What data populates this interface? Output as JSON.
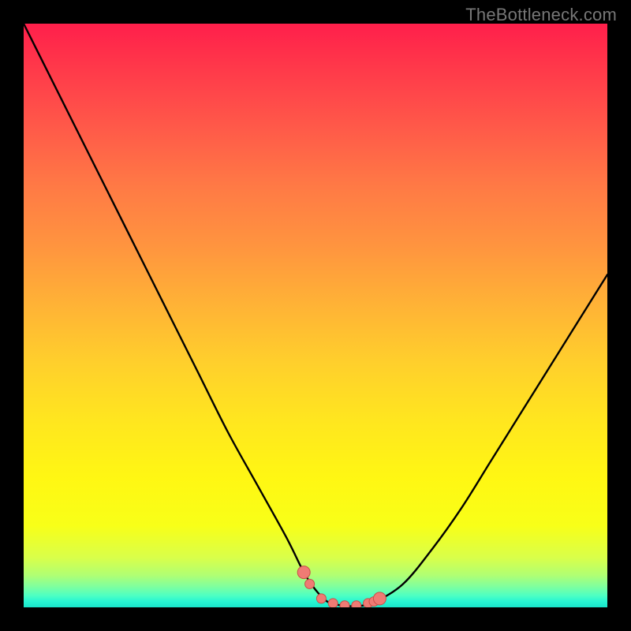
{
  "watermark": "TheBottleneck.com",
  "colors": {
    "frame_bg": "#000000",
    "curve_stroke": "#000000",
    "marker_fill": "#ef7b74",
    "marker_stroke": "#c94f48"
  },
  "chart_data": {
    "type": "line",
    "title": "",
    "xlabel": "",
    "ylabel": "",
    "xlim": [
      0,
      100
    ],
    "ylim": [
      0,
      100
    ],
    "grid": false,
    "legend": false,
    "series": [
      {
        "name": "bottleneck-curve",
        "x": [
          0,
          5,
          10,
          15,
          20,
          25,
          30,
          35,
          40,
          45,
          48,
          50,
          52,
          54,
          56,
          58,
          60,
          65,
          70,
          75,
          80,
          85,
          90,
          95,
          100
        ],
        "values": [
          100,
          90,
          80,
          70,
          60,
          50,
          40,
          30,
          21,
          12,
          6,
          3,
          1,
          0.4,
          0.2,
          0.3,
          0.8,
          4,
          10,
          17,
          25,
          33,
          41,
          49,
          57
        ]
      }
    ],
    "markers": {
      "name": "optimal-range-markers",
      "x": [
        48,
        49,
        51,
        53,
        55,
        57,
        59,
        60,
        61
      ],
      "values": [
        6.0,
        4.0,
        1.5,
        0.7,
        0.3,
        0.3,
        0.7,
        1.0,
        1.5
      ]
    }
  }
}
